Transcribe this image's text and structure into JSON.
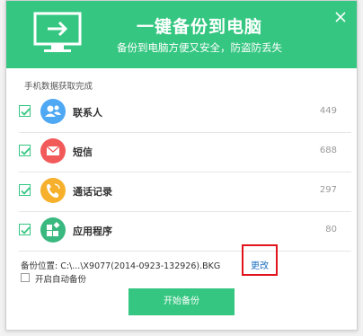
{
  "header": {
    "title": "一键备份到电脑",
    "subtitle": "备份到电脑方便又安全，防盗防丢失"
  },
  "status_text": "手机数据获取完成",
  "items": [
    {
      "label": "联系人",
      "count": "449",
      "icon": "contacts-icon",
      "color": "#4fa8f4"
    },
    {
      "label": "短信",
      "count": "688",
      "icon": "sms-icon",
      "color": "#f25a5a"
    },
    {
      "label": "通话记录",
      "count": "297",
      "icon": "call-log-icon",
      "color": "#f6b02b"
    },
    {
      "label": "应用程序",
      "count": "80",
      "icon": "apps-icon",
      "color": "#39b87f"
    }
  ],
  "backup": {
    "path": "备份位置: C:\\...\\X9077(2014-0923-132926).BKG",
    "change_label": "更改",
    "auto_label": "开启自动备份",
    "auto_checked": false,
    "start_label": "开始备份"
  },
  "colors": {
    "accent": "#35c781",
    "link": "#1a6fc2",
    "highlight": "#e2141b"
  }
}
